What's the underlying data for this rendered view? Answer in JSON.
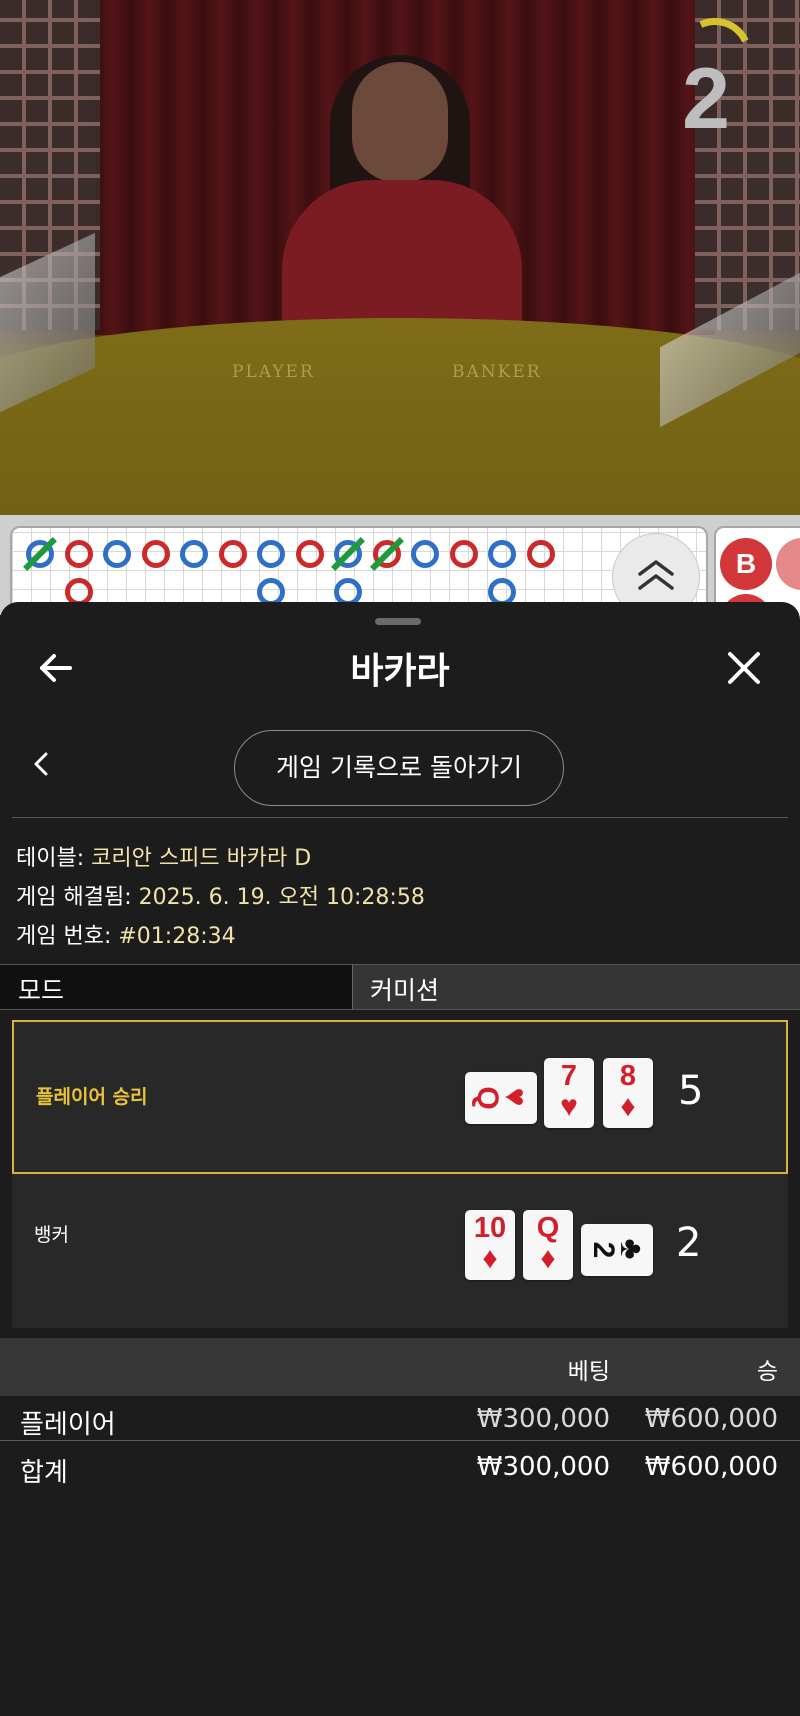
{
  "video": {
    "countdown": "2",
    "felt_labels": {
      "player": "PLAYER",
      "banker": "BANKER"
    }
  },
  "roadmap": {
    "big_road_letter": "B",
    "bead_rings": [
      {
        "side": "P",
        "tie": true
      },
      {
        "side": "B",
        "tie": false
      },
      {
        "side": "P",
        "tie": false
      },
      {
        "side": "B",
        "tie": false
      },
      {
        "side": "P",
        "tie": false
      },
      {
        "side": "B",
        "tie": false
      },
      {
        "side": "P",
        "tie": false
      },
      {
        "side": "B",
        "tie": false
      },
      {
        "side": "P",
        "tie": true
      },
      {
        "side": "B",
        "tie": true
      },
      {
        "side": "P",
        "tie": false
      },
      {
        "side": "B",
        "tie": false
      },
      {
        "side": "P",
        "tie": false
      },
      {
        "side": "B",
        "tie": false
      }
    ]
  },
  "header": {
    "title": "바카라",
    "back_icon": "arrow-left-icon",
    "close_icon": "close-icon"
  },
  "nav": {
    "back_to_history_label": "게임 기록으로 돌아가기"
  },
  "info": {
    "table_label": "테이블: ",
    "table_value": "코리안 스피드 바카라 D",
    "resolved_label": "게임 해결됨: ",
    "resolved_value": "2025. 6. 19. 오전 10:28:58",
    "number_label": "게임 번호: ",
    "number_value": "#01:28:34"
  },
  "mode": {
    "mode_label": "모드",
    "commission_label": "커미션"
  },
  "results": {
    "player": {
      "label": "플레이어 승리",
      "score": "5",
      "label_color": "#e8c43a",
      "cards": [
        {
          "rank": "Q",
          "suit": "♥",
          "orientation": "horizontal",
          "color": "red"
        },
        {
          "rank": "7",
          "suit": "♥",
          "orientation": "vertical",
          "color": "red"
        },
        {
          "rank": "8",
          "suit": "♦",
          "orientation": "vertical",
          "color": "red"
        }
      ]
    },
    "banker": {
      "label": "뱅커",
      "score": "2",
      "cards": [
        {
          "rank": "10",
          "suit": "♦",
          "orientation": "vertical",
          "color": "red"
        },
        {
          "rank": "Q",
          "suit": "♦",
          "orientation": "vertical",
          "color": "red"
        },
        {
          "rank": "2",
          "suit": "♣",
          "orientation": "horizontal",
          "color": "black"
        }
      ]
    }
  },
  "bets": {
    "header_bet": "베팅",
    "header_win": "승",
    "rows": [
      {
        "name": "플레이어",
        "bet": "₩300,000",
        "win": "₩600,000"
      }
    ],
    "total": {
      "name": "합계",
      "bet": "₩300,000",
      "win": "₩600,000"
    }
  }
}
